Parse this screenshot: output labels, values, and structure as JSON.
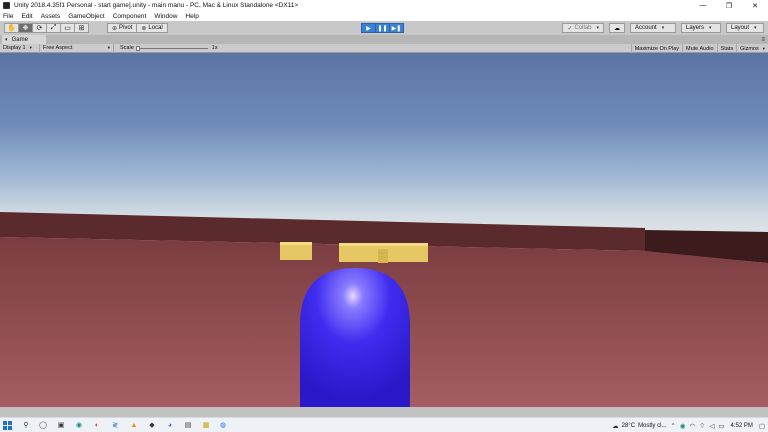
{
  "window": {
    "title": "Unity 2018.4.35f1 Personal - start game].unity - main manu - PC, Mac & Linux Standalone <DX11>",
    "minimize": "—",
    "restore": "❐",
    "close": "✕"
  },
  "menu": [
    "File",
    "Edit",
    "Assets",
    "GameObject",
    "Component",
    "Window",
    "Help"
  ],
  "toolbar": {
    "tools": [
      "✋",
      "✥",
      "⟳",
      "⤢",
      "▭",
      "⊞"
    ],
    "pivot_label": "Pivot",
    "local_label": "Local",
    "play_icons": [
      "▶",
      "❚❚",
      "▶❚"
    ],
    "collab_label": "Collab",
    "cloud_icon": "☁",
    "account_label": "Account",
    "layers_label": "Layers",
    "layout_label": "Layout",
    "dropdown_arrow": "▾"
  },
  "game_tab": {
    "icon": "◐",
    "label": "Game",
    "options_icon": "≡"
  },
  "game_options": {
    "display": "Display 1",
    "aspect": "Free Aspect",
    "scale_label": "Scale",
    "scale_value": "1x",
    "maximize_on_play": "Maximize On Play",
    "mute_audio": "Mute Audio",
    "stats": "Stats",
    "gizmos": "Gizmos"
  },
  "scene": {
    "sky_top": "#5a74a4",
    "sky_horizon": "#e8e8e8",
    "ground_color": "#8a464a",
    "wall_color": "#5b2a2c",
    "block_color": "#e8c860",
    "capsule_color": "#3a24e6"
  },
  "taskbar": {
    "weather_temp": "28°C",
    "weather_desc": "Mostly cl...",
    "time": "4:52 PM"
  }
}
